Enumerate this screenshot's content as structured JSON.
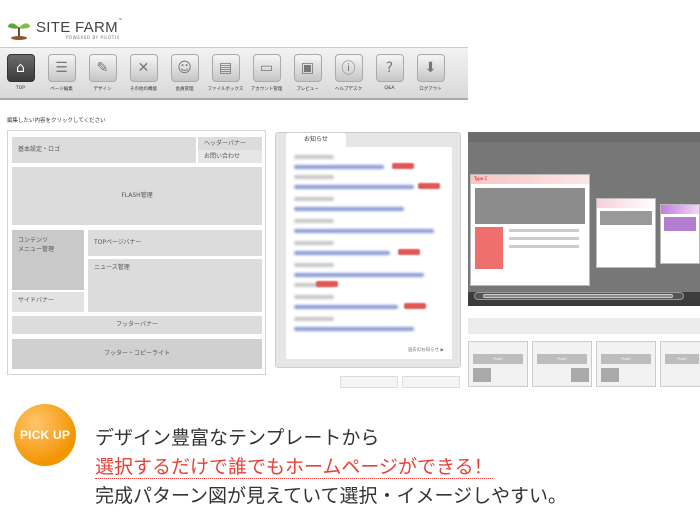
{
  "logo": {
    "name": "SITE FARM",
    "tm": "™",
    "sub": "POWERED BY PILOTIX"
  },
  "nav": [
    {
      "label": "TOP",
      "icon": "home-icon",
      "glyph": "⌂"
    },
    {
      "label": "ページ編集",
      "icon": "document-icon",
      "glyph": "☰"
    },
    {
      "label": "デザイン",
      "icon": "pen-icon",
      "glyph": "✎"
    },
    {
      "label": "その他の機能",
      "icon": "tools-icon",
      "glyph": "✕"
    },
    {
      "label": "会員管理",
      "icon": "user-icon",
      "glyph": "☺"
    },
    {
      "label": "ファイルボックス",
      "icon": "file-box-icon",
      "glyph": "▤"
    },
    {
      "label": "アカウント管理",
      "icon": "account-icon",
      "glyph": "▭"
    },
    {
      "label": "プレビュー",
      "icon": "preview-icon",
      "glyph": "▣"
    },
    {
      "label": "ヘルプデスク",
      "icon": "info-icon",
      "glyph": "ⓘ"
    },
    {
      "label": "Q&A",
      "icon": "question-icon",
      "glyph": "?"
    },
    {
      "label": "ログアウト",
      "icon": "logout-icon",
      "glyph": "⬇"
    }
  ],
  "editor": {
    "instruction": "編集したい内容をクリックしてください",
    "blocks": {
      "basic": "基本設定・ロゴ",
      "header_banner": "ヘッダーバナー",
      "contact": "お問い合わせ",
      "flash": "FLASH管理",
      "contents": "コンテンツ",
      "menu": "メニュー管理",
      "top_banner": "TOPページバナー",
      "news": "ニュース管理",
      "side_banner": "サイドバナー",
      "footer_banner": "フッターバナー",
      "footer_copyright": "フッター・コピーライト"
    }
  },
  "news_panel": {
    "tab": "お知らせ",
    "more": "過去のお知らせ ▶"
  },
  "preview": {
    "card_title": "Type C",
    "flash_label": "Flash"
  },
  "pickup": {
    "badge": "PICK UP",
    "line1": "デザイン豊富なテンプレートから",
    "line2": "選択するだけで誰でもホームページができる！",
    "line3": "完成パターン図が見えていて選択・イメージしやすい。"
  },
  "colors": {
    "accent_orange": "#f39400",
    "accent_red": "#e8413b",
    "nav_active": "#3b3b3b"
  }
}
